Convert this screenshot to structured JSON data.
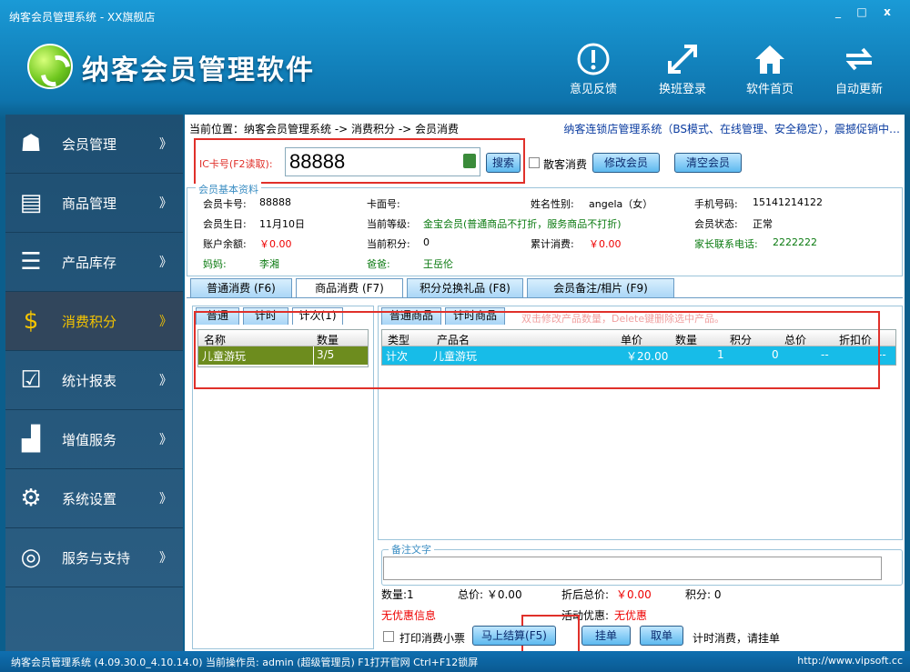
{
  "window": {
    "title": "纳客会员管理系统 - XX旗舰店",
    "min": "_",
    "max": "□",
    "close": "x"
  },
  "header": {
    "app_title": "纳客会员管理软件",
    "nav": [
      {
        "label": "意见反馈",
        "icon": "info-icon"
      },
      {
        "label": "换班登录",
        "icon": "switch-arrows-icon"
      },
      {
        "label": "软件首页",
        "icon": "home-icon"
      },
      {
        "label": "自动更新",
        "icon": "refresh-icon"
      }
    ]
  },
  "sidebar": {
    "items": [
      {
        "label": "会员管理",
        "icon": "user-icon",
        "arrow": "》"
      },
      {
        "label": "商品管理",
        "icon": "document-icon",
        "arrow": "》"
      },
      {
        "label": "产品库存",
        "icon": "cabinet-icon",
        "arrow": "》"
      },
      {
        "label": "消费积分",
        "icon": "money-bag-icon",
        "arrow": "》"
      },
      {
        "label": "统计报表",
        "icon": "clipboard-check-icon",
        "arrow": "》"
      },
      {
        "label": "增值服务",
        "icon": "chart-icon",
        "arrow": "》"
      },
      {
        "label": "系统设置",
        "icon": "gear-icon",
        "arrow": "》"
      },
      {
        "label": "服务与支持",
        "icon": "globe-icon",
        "arrow": "》"
      }
    ]
  },
  "main": {
    "breadcrumb": "当前位置：纳客会员管理系统 -> 消费积分 -> 会员消费",
    "ad": "纳客连锁店管理系统（BS模式、在线管理、安全稳定），震撼促销中…",
    "card": {
      "label": "IC卡号(F2读取):",
      "value": "88888",
      "search": "搜索",
      "walkin": "散客消费",
      "edit": "修改会员",
      "clear": "清空会员"
    },
    "member": {
      "group_title": "会员基本资料",
      "card_no_label": "会员卡号:",
      "card_no": "88888",
      "face_label": "卡面号:",
      "face": "",
      "name_label": "姓名性别:",
      "name": "angela（女）",
      "phone_label": "手机号码:",
      "phone": "15141214122",
      "birthday_label": "会员生日:",
      "birthday": "11月10日",
      "level_label": "当前等级:",
      "level": "金宝会员(普通商品不打折，服务商品不打折)",
      "state_label": "会员状态:",
      "state": "正常",
      "balance_label": "账户余额:",
      "balance": "￥0.00",
      "points_label": "当前积分:",
      "points": "0",
      "total_label": "累计消费:",
      "total": "￥0.00",
      "parent_phone_label": "家长联系电话:",
      "parent_phone": "2222222",
      "mom_label": "妈妈:",
      "mom": "李湘",
      "dad_label": "爸爸:",
      "dad": "王岳伦"
    },
    "tabs": [
      "普通消费 (F6)",
      "商品消费 (F7)",
      "积分兑换礼品 (F8)",
      "会员备注/相片 (F9)"
    ],
    "left_tabs": [
      "普通",
      "计时",
      "计次(1)"
    ],
    "left_grid": {
      "headers": [
        "名称",
        "数量"
      ],
      "rows": [
        [
          "儿童游玩",
          "3/5"
        ]
      ]
    },
    "right_tabs": [
      "普通商品",
      "计时商品"
    ],
    "hint": "双击修改产品数量，Delete键删除选中产品。",
    "right_grid": {
      "headers": [
        "类型",
        "产品名",
        "单价",
        "数量",
        "积分",
        "总价",
        "折扣价"
      ],
      "rows": [
        [
          "计次",
          "儿童游玩",
          "￥20.00",
          "1",
          "0",
          "--",
          "--"
        ]
      ]
    },
    "note_title": "备注文字",
    "summary": {
      "qty": "数量:1",
      "total": "总价: ￥0.00",
      "disc": "折后总价:",
      "disc_val": "￥0.00",
      "pts": "积分: 0",
      "no_discount": "无优惠信息",
      "promo": "活动优惠:",
      "promo_val": "无优惠"
    },
    "actions": {
      "print": "打印消费小票",
      "checkout": "马上结算(F5)",
      "hang": "挂单",
      "take": "取单",
      "tip": "计时消费，请挂单"
    }
  },
  "status": {
    "left": "纳客会员管理系统 (4.09.30.0_4.10.14.0)  当前操作员: admin (超级管理员)  F1打开官网 Ctrl+F12锁屏",
    "right": "http://www.vipsoft.cc"
  },
  "colors": {
    "accent": "#0e74ad",
    "sidebar": "#1e4f72",
    "active": "#f5c400",
    "highlight": "#17bce8",
    "left_row": "#6d8c1e"
  }
}
